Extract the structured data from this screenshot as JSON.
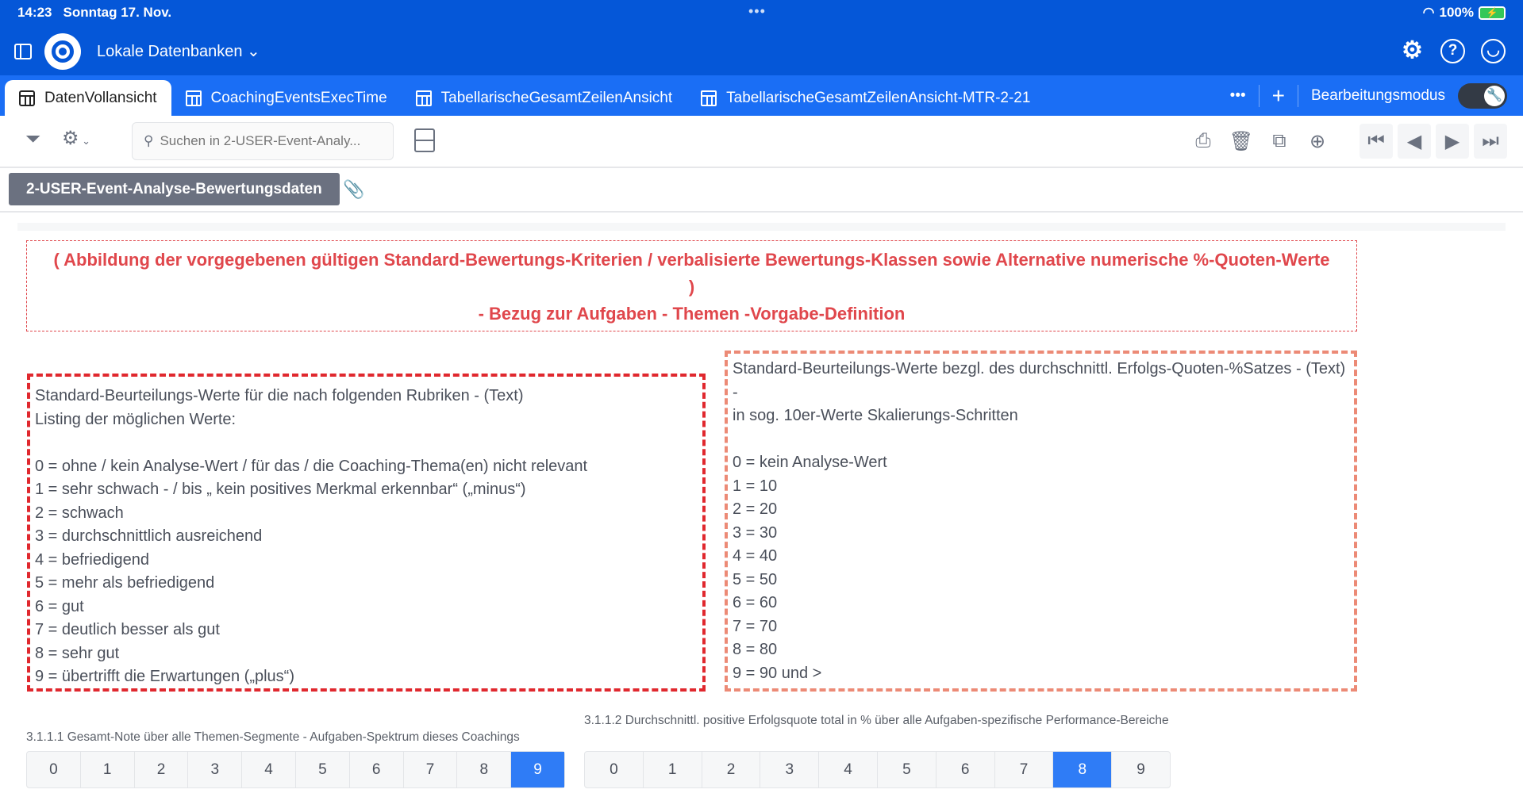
{
  "status": {
    "time": "14:23",
    "date": "Sonntag 17. Nov.",
    "battery": "100%"
  },
  "header": {
    "database": "Lokale Datenbanken"
  },
  "tabs": [
    {
      "label": "DatenVollansicht"
    },
    {
      "label": "CoachingEventsExecTime"
    },
    {
      "label": "TabellarischeGesamtZeilenAnsicht"
    },
    {
      "label": "TabellarischeGesamtZeilenAnsicht-MTR-2-21"
    }
  ],
  "tabbar": {
    "more": "•••",
    "add": "+",
    "edit_mode": "Bearbeitungsmodus",
    "edit_mode_on": true
  },
  "toolbar": {
    "search_placeholder": "Suchen in 2-USER-Event-Analy..."
  },
  "record": {
    "title": "2-USER-Event-Analyse-Bewertungsdaten"
  },
  "banner": {
    "line1": "( Abbildung der vorgegebenen gültigen Standard-Bewertungs-Kriterien / verbalisierte Bewertungs-Klassen sowie Alternative numerische %-Quoten-Werte )",
    "line2": "- Bezug zur Aufgaben - Themen -Vorgabe-Definition"
  },
  "left_box": {
    "text": "Standard-Beurteilungs-Werte für die nach folgenden Rubriken - (Text)\nListing der möglichen Werte:\n\n0 = ohne / kein Analyse-Wert / für das / die Coaching-Thema(en) nicht relevant\n1 = sehr schwach - / bis „ kein positives Merkmal erkennbar“ („minus“)\n2 = schwach\n3 = durchschnittlich ausreichend\n4 = befriedigend\n5 = mehr als befriedigend\n6 = gut\n7 = deutlich besser als gut\n8 = sehr gut\n9 = übertrifft die Erwartungen („plus“)"
  },
  "right_box": {
    "text": "Standard-Beurteilungs-Werte bezgl. des durchschnittl. Erfolgs-Quoten-%Satzes - (Text) -\nin sog. 10er-Werte Skalierungs-Schritten\n\n0 = kein Analyse-Wert\n1 = 10\n2 = 20\n3 = 30\n4 = 40\n5 = 50\n6 = 60\n7 = 70\n8 = 80\n9 = 90 und >"
  },
  "field1": {
    "label": "3.1.1.1 Gesamt-Note über alle Themen-Segmente - Aufgaben-Spektrum dieses Coachings",
    "options": [
      "0",
      "1",
      "2",
      "3",
      "4",
      "5",
      "6",
      "7",
      "8",
      "9"
    ],
    "selected": "9"
  },
  "field2": {
    "label": "3.1.1.2 Durchschnittl. positive Erfolgsquote total in % über alle Aufgaben-spezifische Performance-Bereiche",
    "options": [
      "0",
      "1",
      "2",
      "3",
      "4",
      "5",
      "6",
      "7",
      "8",
      "9"
    ],
    "selected": "8"
  }
}
